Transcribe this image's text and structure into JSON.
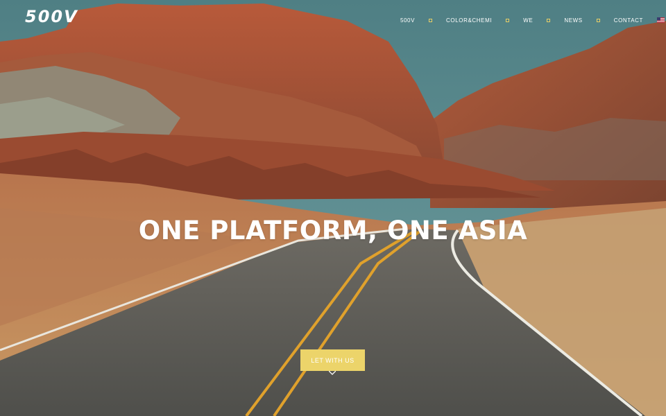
{
  "header": {
    "logo_text": "500V",
    "nav": [
      {
        "label": "500V"
      },
      {
        "label": "COLOR&CHEMI"
      },
      {
        "label": "WE"
      },
      {
        "label": "NEWS"
      },
      {
        "label": "CONTACT"
      }
    ],
    "language_icon": "us-flag-icon"
  },
  "hero": {
    "headline": "ONE PLATFORM, ONE ASIA",
    "cta_label": "LET WITH US"
  },
  "colors": {
    "accent": "#ecd46a",
    "nav_separator": "#e8cf66",
    "text": "#ffffff"
  }
}
